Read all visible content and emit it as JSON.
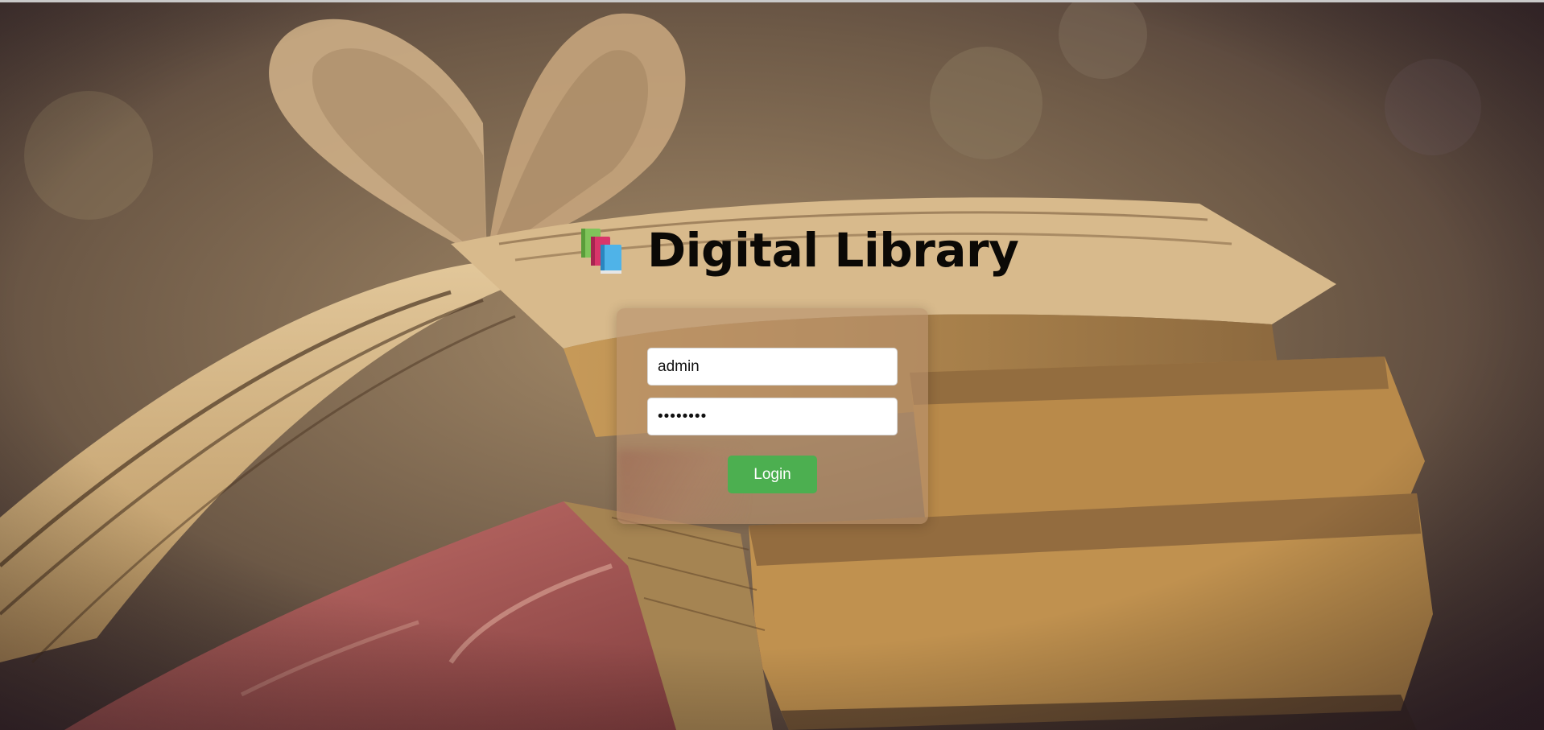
{
  "app": {
    "title": "Digital Library",
    "logo_icon": "books-icon"
  },
  "login_form": {
    "username": {
      "value": "admin",
      "type": "text"
    },
    "password": {
      "value": "password",
      "type": "password"
    },
    "submit_label": "Login"
  },
  "colors": {
    "login_button": "#4caf50",
    "login_button_text": "#ffffff",
    "title_text": "#0b0906",
    "card_background": "rgba(184,146,110,0.62)"
  },
  "background": {
    "description_icon": "heart-shaped-book-pages-image"
  }
}
